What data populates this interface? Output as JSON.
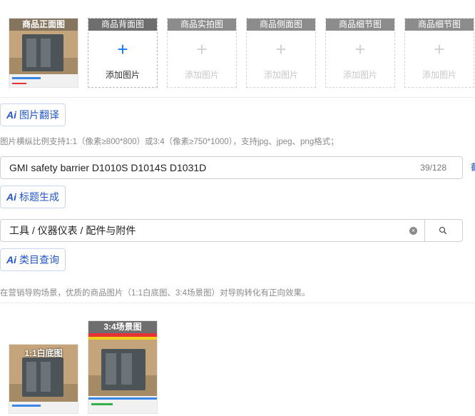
{
  "slots": [
    {
      "label": "商品正面图",
      "state": "filled"
    },
    {
      "label": "商品背面图",
      "state": "active",
      "add_text": "添加图片"
    },
    {
      "label": "商品实拍图",
      "state": "empty",
      "add_text": "添加图片"
    },
    {
      "label": "商品侧面图",
      "state": "empty",
      "add_text": "添加图片"
    },
    {
      "label": "商品细节图",
      "state": "empty",
      "add_text": "添加图片"
    },
    {
      "label": "商品细节图",
      "state": "empty",
      "add_text": "添加图片"
    }
  ],
  "ai_buttons": {
    "logo": "Ai",
    "translate": "图片翻译",
    "title_gen": "标题生成",
    "category_query": "类目查询"
  },
  "hint_ratio": "图片横纵比例支持1:1（像素≥800*800）或3:4（像素≥750*1000），支持jpg、jpeg、png格式；",
  "title_input": {
    "value": "GMI safety barrier D1010S D1014S D1031D",
    "count": "39/128"
  },
  "edge_char": "截",
  "category_input": {
    "value": "工具 / 仪器仪表 / 配件与附件"
  },
  "hint_marketing": "在营销导购场景，优质的商品图片（1:1白底图、3:4场景图）对导购转化有正向效果。",
  "marketing_images": [
    {
      "label": "1:1白底图"
    },
    {
      "label": "3:4场景图"
    }
  ],
  "icons": {
    "plus": "+",
    "clear": "×",
    "search": "search-icon"
  }
}
